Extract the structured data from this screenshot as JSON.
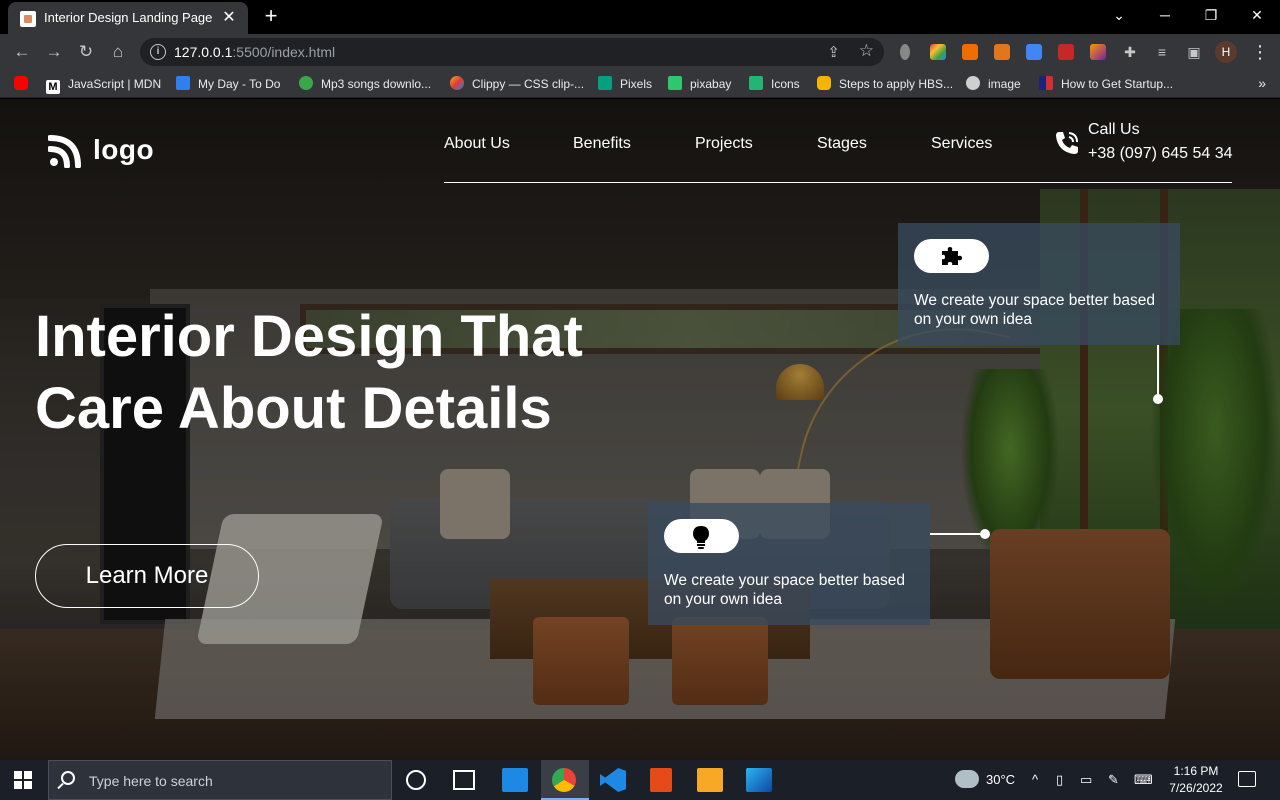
{
  "browser": {
    "tab_title": "Interior Design Landing Page",
    "tab_close": "✕",
    "new_tab": "+",
    "url_host": "127.0.0.1",
    "url_rest": ":5500/index.html",
    "window_controls": {
      "minimize": "─",
      "maximize": "❐",
      "close": "✕",
      "dropdown": "⌄"
    },
    "profile_initial": "H"
  },
  "bookmarks": [
    {
      "label": "",
      "icon": "youtube-icon",
      "color": "#ff0000"
    },
    {
      "label": "JavaScript | MDN",
      "icon": "mdn-icon",
      "color": "#1b1b1b"
    },
    {
      "label": "My Day - To Do",
      "icon": "todo-check-icon",
      "color": "#2f80ed"
    },
    {
      "label": "Mp3 songs downlo...",
      "icon": "mp3-icon",
      "color": "#3aa84a"
    },
    {
      "label": "Clippy — CSS clip-...",
      "icon": "clippy-icon",
      "color": "#e8b41b"
    },
    {
      "label": "Pixels",
      "icon": "pixels-icon",
      "color": "#05a081"
    },
    {
      "label": "pixabay",
      "icon": "pixabay-icon",
      "color": "#2ec66e"
    },
    {
      "label": "Icons",
      "icon": "icons-icon",
      "color": "#22b573"
    },
    {
      "label": "Steps to apply HBS...",
      "icon": "hbs-icon",
      "color": "#f4b400"
    },
    {
      "label": "image",
      "icon": "image-icon",
      "color": "#cfcfcf"
    },
    {
      "label": "How to Get Startup...",
      "icon": "startup-flag-icon",
      "color": "#d32f2f"
    }
  ],
  "site": {
    "logo_text": "logo",
    "nav": [
      "About Us",
      "Benefits",
      "Projects",
      "Stages",
      "Services"
    ],
    "call_label": "Call Us",
    "phone": "+38 (097) 645 54 34",
    "hero_line1": "Interior Design That",
    "hero_line2": "Care About Details",
    "cta": "Learn More",
    "cards": [
      {
        "icon": "puzzle-icon",
        "text": "We create your space better based on your own idea"
      },
      {
        "icon": "lightbulb-icon",
        "text": "We create your space better based on your own idea"
      }
    ]
  },
  "taskbar": {
    "search_placeholder": "Type here to search",
    "weather": "30°C",
    "time": "1:16 PM",
    "date": "7/26/2022"
  }
}
